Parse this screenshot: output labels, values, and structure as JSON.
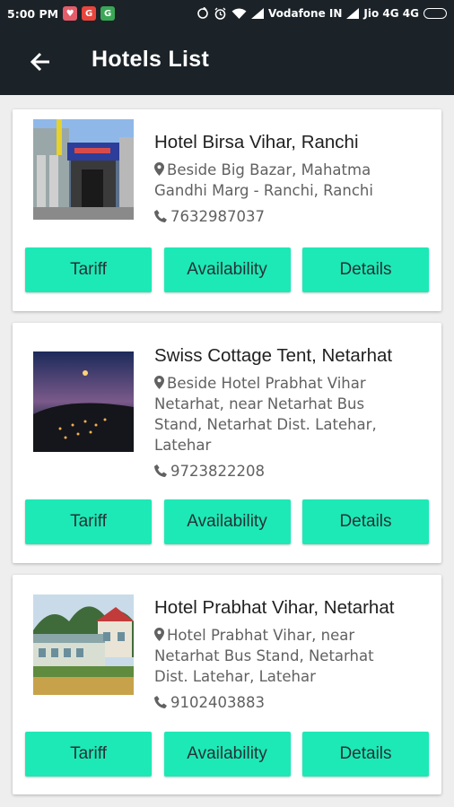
{
  "status_bar": {
    "time": "5:00 PM",
    "carrier1": "Vodafone IN",
    "carrier2": "Jio 4G 4G"
  },
  "app_bar": {
    "title": "Hotels List"
  },
  "buttons": {
    "tariff": "Tariff",
    "availability": "Availability",
    "details": "Details"
  },
  "hotels": [
    {
      "name": "Hotel Birsa Vihar, Ranchi",
      "address_lines": [
        "Beside Big Bazar, Mahatma",
        "Gandhi Marg - Ranchi, Ranchi"
      ],
      "phone": "7632987037"
    },
    {
      "name": "Swiss Cottage Tent, Netarhat",
      "address_lines": [
        "Beside Hotel Prabhat Vihar",
        "Netarhat, near Netarhat Bus",
        "Stand, Netarhat Dist. Latehar,",
        "Latehar"
      ],
      "phone": "9723822208"
    },
    {
      "name": "Hotel Prabhat Vihar, Netarhat",
      "address_lines": [
        "Hotel Prabhat Vihar, near",
        "Netarhat Bus Stand, Netarhat",
        "Dist. Latehar, Latehar"
      ],
      "phone": "9102403883"
    }
  ],
  "colors": {
    "app_bar": "#1b2228",
    "button": "#1de9b6",
    "background": "#eeeeee"
  }
}
